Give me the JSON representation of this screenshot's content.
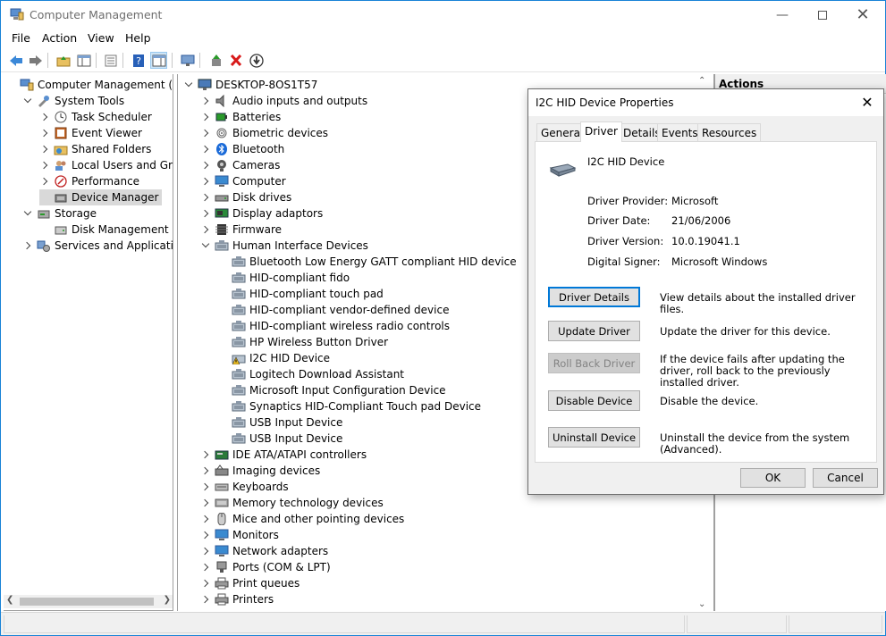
{
  "window": {
    "title": "Computer Management"
  },
  "menu": [
    "File",
    "Action",
    "View",
    "Help"
  ],
  "left_tree": [
    {
      "label": "Computer Management (Local",
      "level": 0,
      "expander": "none",
      "icon": "computer-management-icon"
    },
    {
      "label": "System Tools",
      "level": 1,
      "expander": "open",
      "icon": "tools-icon"
    },
    {
      "label": "Task Scheduler",
      "level": 2,
      "expander": "closed",
      "icon": "clock-icon"
    },
    {
      "label": "Event Viewer",
      "level": 2,
      "expander": "closed",
      "icon": "event-viewer-icon"
    },
    {
      "label": "Shared Folders",
      "level": 2,
      "expander": "closed",
      "icon": "shared-folder-icon"
    },
    {
      "label": "Local Users and Groups",
      "level": 2,
      "expander": "closed",
      "icon": "users-icon"
    },
    {
      "label": "Performance",
      "level": 2,
      "expander": "closed",
      "icon": "performance-icon"
    },
    {
      "label": "Device Manager",
      "level": 2,
      "expander": "none",
      "icon": "device-manager-icon",
      "selected": true
    },
    {
      "label": "Storage",
      "level": 1,
      "expander": "open",
      "icon": "storage-icon"
    },
    {
      "label": "Disk Management",
      "level": 2,
      "expander": "none",
      "icon": "disk-icon"
    },
    {
      "label": "Services and Applications",
      "level": 1,
      "expander": "closed",
      "icon": "services-icon"
    }
  ],
  "device_tree": [
    {
      "label": "DESKTOP-8OS1T57",
      "level": 0,
      "expander": "open",
      "icon": "computer-icon"
    },
    {
      "label": "Audio inputs and outputs",
      "level": 1,
      "expander": "closed",
      "icon": "speaker-icon"
    },
    {
      "label": "Batteries",
      "level": 1,
      "expander": "closed",
      "icon": "battery-icon"
    },
    {
      "label": "Biometric devices",
      "level": 1,
      "expander": "closed",
      "icon": "fingerprint-icon"
    },
    {
      "label": "Bluetooth",
      "level": 1,
      "expander": "closed",
      "icon": "bluetooth-icon"
    },
    {
      "label": "Cameras",
      "level": 1,
      "expander": "closed",
      "icon": "camera-icon"
    },
    {
      "label": "Computer",
      "level": 1,
      "expander": "closed",
      "icon": "monitor-icon"
    },
    {
      "label": "Disk drives",
      "level": 1,
      "expander": "closed",
      "icon": "disk-drive-icon"
    },
    {
      "label": "Display adaptors",
      "level": 1,
      "expander": "closed",
      "icon": "display-adapter-icon"
    },
    {
      "label": "Firmware",
      "level": 1,
      "expander": "closed",
      "icon": "firmware-icon"
    },
    {
      "label": "Human Interface Devices",
      "level": 1,
      "expander": "open",
      "icon": "hid-icon"
    },
    {
      "label": "Bluetooth Low Energy GATT compliant HID device",
      "level": 2,
      "expander": "none",
      "icon": "hid-icon"
    },
    {
      "label": "HID-compliant fido",
      "level": 2,
      "expander": "none",
      "icon": "hid-icon"
    },
    {
      "label": "HID-compliant touch pad",
      "level": 2,
      "expander": "none",
      "icon": "hid-icon"
    },
    {
      "label": "HID-compliant vendor-defined device",
      "level": 2,
      "expander": "none",
      "icon": "hid-icon"
    },
    {
      "label": "HID-compliant wireless radio controls",
      "level": 2,
      "expander": "none",
      "icon": "hid-icon"
    },
    {
      "label": "HP Wireless Button Driver",
      "level": 2,
      "expander": "none",
      "icon": "hid-icon"
    },
    {
      "label": "I2C HID Device",
      "level": 2,
      "expander": "none",
      "icon": "hid-warning-icon"
    },
    {
      "label": "Logitech Download Assistant",
      "level": 2,
      "expander": "none",
      "icon": "hid-icon"
    },
    {
      "label": "Microsoft Input Configuration Device",
      "level": 2,
      "expander": "none",
      "icon": "hid-icon"
    },
    {
      "label": "Synaptics HID-Compliant Touch pad Device",
      "level": 2,
      "expander": "none",
      "icon": "hid-icon"
    },
    {
      "label": "USB Input Device",
      "level": 2,
      "expander": "none",
      "icon": "hid-icon"
    },
    {
      "label": "USB Input Device",
      "level": 2,
      "expander": "none",
      "icon": "hid-icon"
    },
    {
      "label": "IDE ATA/ATAPI controllers",
      "level": 1,
      "expander": "closed",
      "icon": "ide-icon"
    },
    {
      "label": "Imaging devices",
      "level": 1,
      "expander": "closed",
      "icon": "scanner-icon"
    },
    {
      "label": "Keyboards",
      "level": 1,
      "expander": "closed",
      "icon": "keyboard-icon"
    },
    {
      "label": "Memory technology devices",
      "level": 1,
      "expander": "closed",
      "icon": "memory-icon"
    },
    {
      "label": "Mice and other pointing devices",
      "level": 1,
      "expander": "closed",
      "icon": "mouse-icon"
    },
    {
      "label": "Monitors",
      "level": 1,
      "expander": "closed",
      "icon": "monitor-icon"
    },
    {
      "label": "Network adapters",
      "level": 1,
      "expander": "closed",
      "icon": "network-icon"
    },
    {
      "label": "Ports (COM & LPT)",
      "level": 1,
      "expander": "closed",
      "icon": "port-icon"
    },
    {
      "label": "Print queues",
      "level": 1,
      "expander": "closed",
      "icon": "printer-icon"
    },
    {
      "label": "Printers",
      "level": 1,
      "expander": "closed",
      "icon": "printer-icon"
    }
  ],
  "actions": {
    "title": "Actions"
  },
  "dialog": {
    "title": "I2C HID Device Properties",
    "tabs": [
      "General",
      "Driver",
      "Details",
      "Events",
      "Resources"
    ],
    "active_tab": "Driver",
    "device_name": "I2C HID Device",
    "fields": [
      {
        "label": "Driver Provider:",
        "value": "Microsoft"
      },
      {
        "label": "Driver Date:",
        "value": "21/06/2006"
      },
      {
        "label": "Driver Version:",
        "value": "10.0.19041.1"
      },
      {
        "label": "Digital Signer:",
        "value": "Microsoft Windows"
      }
    ],
    "buttons": [
      {
        "label": "Driver Details",
        "desc": "View details about the installed driver files.",
        "state": "focused"
      },
      {
        "label": "Update Driver",
        "desc": "Update the driver for this device.",
        "state": "normal"
      },
      {
        "label": "Roll Back Driver",
        "desc": "If the device fails after updating the driver, roll back to the previously installed driver.",
        "state": "disabled"
      },
      {
        "label": "Disable Device",
        "desc": "Disable the device.",
        "state": "normal"
      },
      {
        "label": "Uninstall Device",
        "desc": "Uninstall the device from the system (Advanced).",
        "state": "normal"
      }
    ],
    "ok_label": "OK",
    "cancel_label": "Cancel"
  },
  "colors": {
    "accent": "#0078d7",
    "selected": "#d9d9d9",
    "border": "#1883d7"
  }
}
